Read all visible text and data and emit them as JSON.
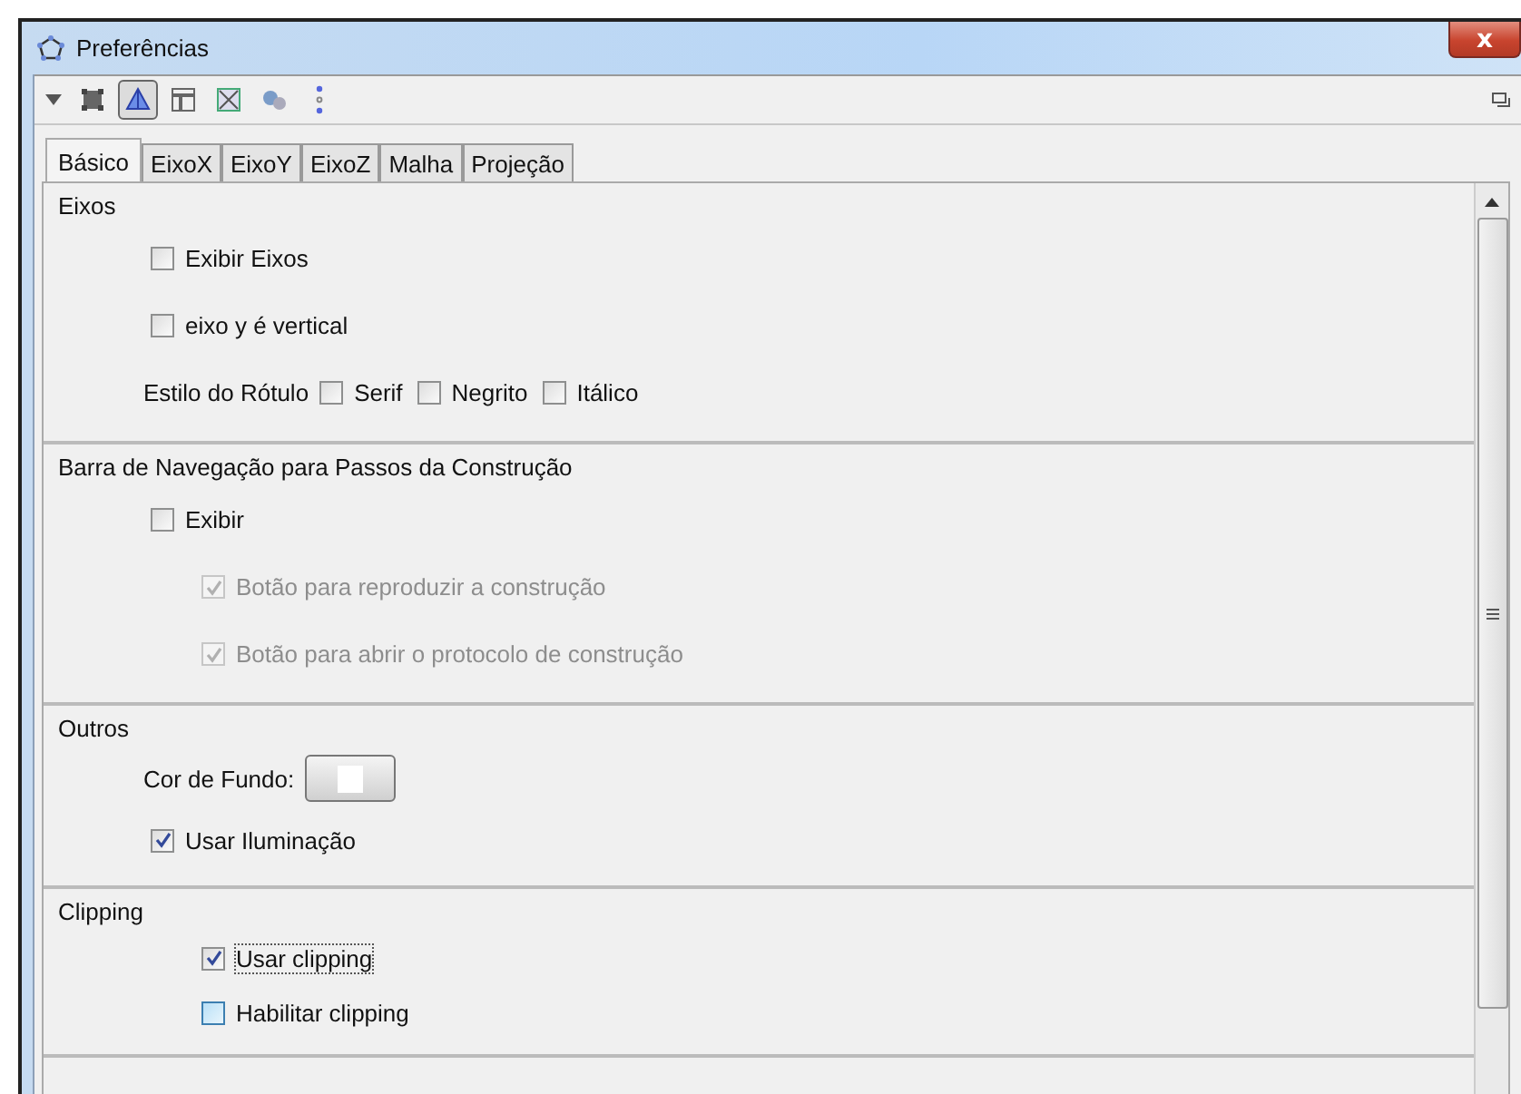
{
  "window": {
    "title": "Preferências",
    "close": "x"
  },
  "toolbar": {
    "buttons": [
      {
        "selected": false
      },
      {
        "selected": true
      },
      {
        "selected": false
      },
      {
        "selected": false
      },
      {
        "selected": false
      },
      {
        "selected": false
      }
    ]
  },
  "tabs": [
    {
      "label": "Básico",
      "selected": true
    },
    {
      "label": "EixoX",
      "selected": false
    },
    {
      "label": "EixoY",
      "selected": false
    },
    {
      "label": "EixoZ",
      "selected": false
    },
    {
      "label": "Malha",
      "selected": false
    },
    {
      "label": "Projeção",
      "selected": false
    }
  ],
  "sections": [
    {
      "title": "Eixos",
      "rows": [
        {
          "kind": "checkbox",
          "label": "Exibir Eixos",
          "checked": false,
          "disabled": false
        },
        {
          "kind": "checkbox",
          "label": "eixo y é vertical",
          "checked": false,
          "disabled": false
        },
        {
          "kind": "group",
          "label": "Estilo do Rótulo",
          "options": [
            {
              "label": "Serif",
              "checked": false
            },
            {
              "label": "Negrito",
              "checked": false
            },
            {
              "label": "Itálico",
              "checked": false
            }
          ]
        }
      ]
    },
    {
      "title": "Barra de Navegação para Passos da Construção",
      "rows": [
        {
          "kind": "checkbox",
          "label": "Exibir",
          "checked": false,
          "disabled": false
        },
        {
          "kind": "subcheckbox",
          "label": "Botão para reproduzir a construção",
          "checked": true,
          "disabled": true
        },
        {
          "kind": "subcheckbox",
          "label": "Botão para abrir o protocolo de construção",
          "checked": true,
          "disabled": true
        }
      ]
    },
    {
      "title": "Outros",
      "rows": [
        {
          "kind": "color",
          "label": "Cor de Fundo:",
          "color": "#ffffff"
        },
        {
          "kind": "checkbox",
          "label": "Usar Iluminação",
          "checked": true,
          "disabled": false
        }
      ]
    },
    {
      "title": "Clipping",
      "rows": [
        {
          "kind": "subcheckbox",
          "label": "Usar clipping",
          "checked": true,
          "disabled": false,
          "focused": true
        },
        {
          "kind": "subcheckbox",
          "label": "Habilitar clipping",
          "checked": false,
          "disabled": false,
          "hovered": true
        }
      ]
    }
  ]
}
